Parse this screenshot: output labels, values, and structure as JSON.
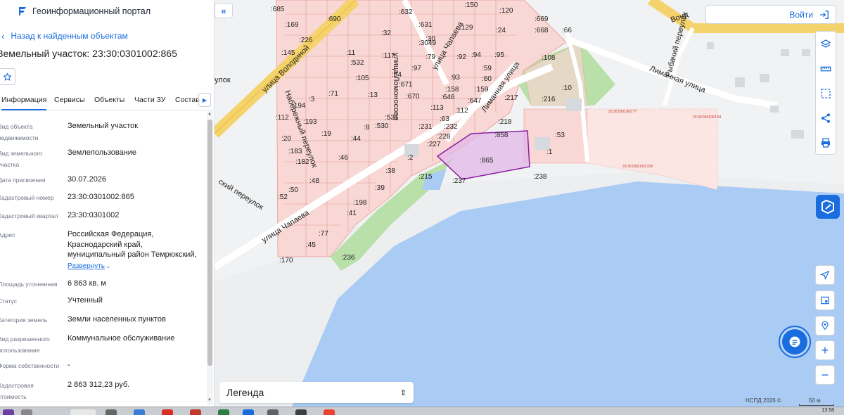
{
  "portal": {
    "title": "Геоинформационный портал"
  },
  "nav": {
    "back_label": "Назад к найденным объектам"
  },
  "object": {
    "title": "Земельный участок: 23:30:0301002:865"
  },
  "tabs": [
    {
      "label": "Информация",
      "active": true
    },
    {
      "label": "Сервисы"
    },
    {
      "label": "Объекты"
    },
    {
      "label": "Части ЗУ"
    },
    {
      "label": "Состав"
    }
  ],
  "properties": [
    {
      "label": "Вид объекта недвижимости",
      "value": "Земельный участок"
    },
    {
      "label": "Вид земельного участка",
      "value": "Землепользование"
    },
    {
      "label": "Дата присвоения",
      "value": "30.07.2026"
    },
    {
      "label": "Кадастровый номер",
      "value": "23:30:0301002:865"
    },
    {
      "label": "Кадастровый квартал",
      "value": "23:30:0301002"
    },
    {
      "label": "Адрес",
      "value": "Российская Федерация, Краснодарский край, муниципальный район Темрюкский,"
    },
    {
      "label": "Площадь уточненная",
      "value": "6 863 кв. м"
    },
    {
      "label": "Статус",
      "value": "Учтенный"
    },
    {
      "label": "Категория земель",
      "value": "Земли населенных пунктов"
    },
    {
      "label": "Вид разрешенного использования",
      "value": "Коммунальное обслуживание"
    },
    {
      "label": "Форма собственности",
      "value": "-"
    },
    {
      "label": "Кадастровая стоимость",
      "value": "2 863 312,23 руб."
    }
  ],
  "address_expand": "Развернуть",
  "map": {
    "login_label": "Войти",
    "legend_label": "Легенда",
    "copyright": "НСПД 2026 ©",
    "scale": "50 м",
    "streets": {
      "volodinoy": "улица Володиной",
      "chapaeva_upper": "улица Чапаева",
      "chapaeva_lower": "улица Чапаева",
      "krasnyy_per": "Набережный переулок",
      "lomonosova": "улица Ломоносова",
      "limannaya_diag": "Лиманная улица",
      "limannaya": "Лиманная улица",
      "rybachiy": "Рыбачий переулок",
      "mayakovskiy": "ский переулок",
      "ulok": "улок",
      "vonda": "Вонд"
    },
    "parcels": [
      ":685",
      ":690",
      ":632",
      ":150",
      ":120",
      ":669",
      ":169",
      ":631",
      ":129",
      ":24",
      ":668",
      ":66",
      ":32",
      ":3049",
      ":30",
      ":226",
      ":145",
      ":11",
      ":532",
      ":117",
      ":79",
      ":92",
      ":94",
      ":95",
      ":108",
      ":97",
      ":93",
      ":60",
      ":105",
      ":84",
      ":671",
      ":158",
      ":159",
      ":10",
      ":71",
      ":13",
      ":670",
      ":646",
      ":647",
      ":217",
      ":216",
      ":194",
      ":3",
      ":113",
      ":112",
      ":112",
      ":193",
      ":531",
      ":63",
      ":218",
      ":19",
      ":8",
      ":530",
      ":231",
      ":232",
      ":228",
      ":858",
      ":53",
      ":20",
      ":44",
      ":227",
      ":1",
      ":183",
      ":46",
      ":2",
      ":865",
      ":182",
      ":38",
      ":215",
      ":237",
      ":238",
      ":48",
      ":50",
      ":39",
      ":198",
      ":52",
      ":41",
      ":77",
      ":45",
      ":236",
      ":170",
      ":59"
    ],
    "quarter_labels": [
      "23:30:0301002:??",
      "23:30:0301002:239",
      "23:30:0301002:94"
    ]
  },
  "taskbar": {
    "clock": "13:58"
  },
  "colors": {
    "accent": "#1a6ddf",
    "selected_parcel": "#e3b7e8",
    "water": "#a9cbf4",
    "green": "#b9e0a8"
  }
}
